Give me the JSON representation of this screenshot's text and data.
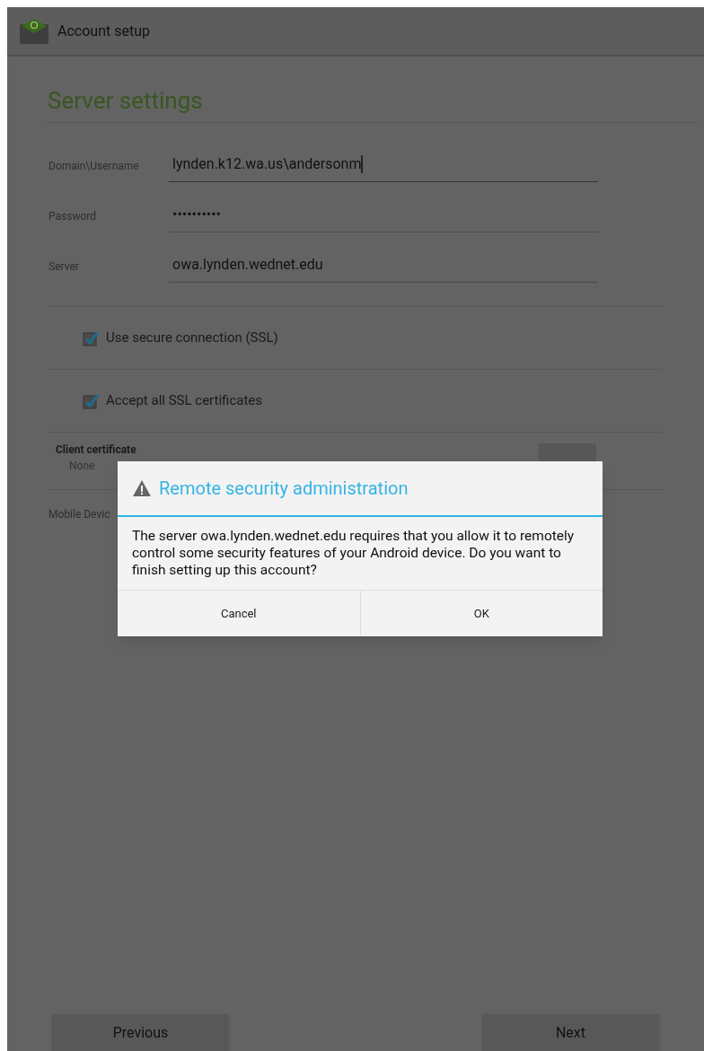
{
  "app_bar": {
    "title": "Account setup"
  },
  "heading": "Server settings",
  "fields": [
    {
      "label": "Domain\\Username",
      "value": "lynden.k12.wa.us\\andersonm",
      "focused": true
    },
    {
      "label": "Password",
      "value": "••••••••••",
      "focused": false
    },
    {
      "label": "Server",
      "value": "owa.lynden.wednet.edu",
      "focused": false
    }
  ],
  "checkboxes": [
    {
      "label": "Use secure connection (SSL)",
      "checked": true
    },
    {
      "label": "Accept all SSL certificates",
      "checked": true
    }
  ],
  "client_certificate": {
    "label": "Client certificate",
    "value": "None"
  },
  "mobile_device_label": "Mobile Devic",
  "dialog": {
    "title": "Remote security administration",
    "message": "The server owa.lynden.wednet.edu requires that you allow it to remotely control some security features of your Android device. Do you want to finish setting up this account?",
    "buttons": [
      "Cancel",
      "OK"
    ]
  },
  "footer_buttons": [
    "Previous",
    "Next"
  ]
}
